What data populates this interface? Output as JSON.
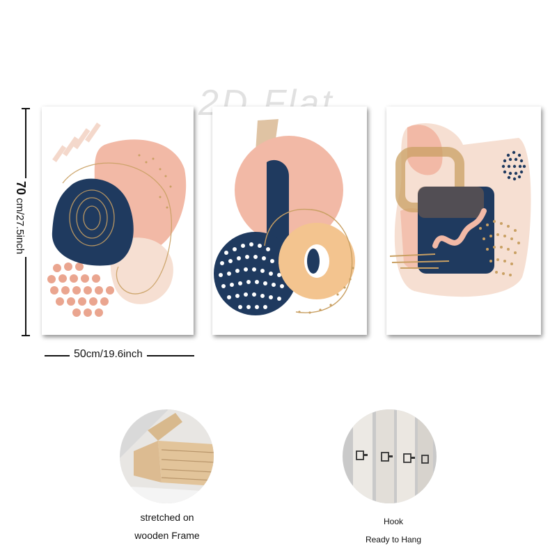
{
  "watermark": "2D Flat",
  "dimensions": {
    "height_value": "70",
    "height_unit": "cm/27.5inch",
    "width_value": "50",
    "width_unit": "cm/19.6inch"
  },
  "panels": [
    {
      "name": "left-print"
    },
    {
      "name": "middle-print"
    },
    {
      "name": "right-print"
    }
  ],
  "features": {
    "frame": {
      "line1": "stretched on",
      "line2": "wooden Frame"
    },
    "hook": {
      "line1": "Hook",
      "line2": "Ready to Hang"
    }
  },
  "colors": {
    "navy": "#1f3a5f",
    "peach": "#f2b9a6",
    "cream": "#f5dccb",
    "gold": "#b8935a"
  }
}
